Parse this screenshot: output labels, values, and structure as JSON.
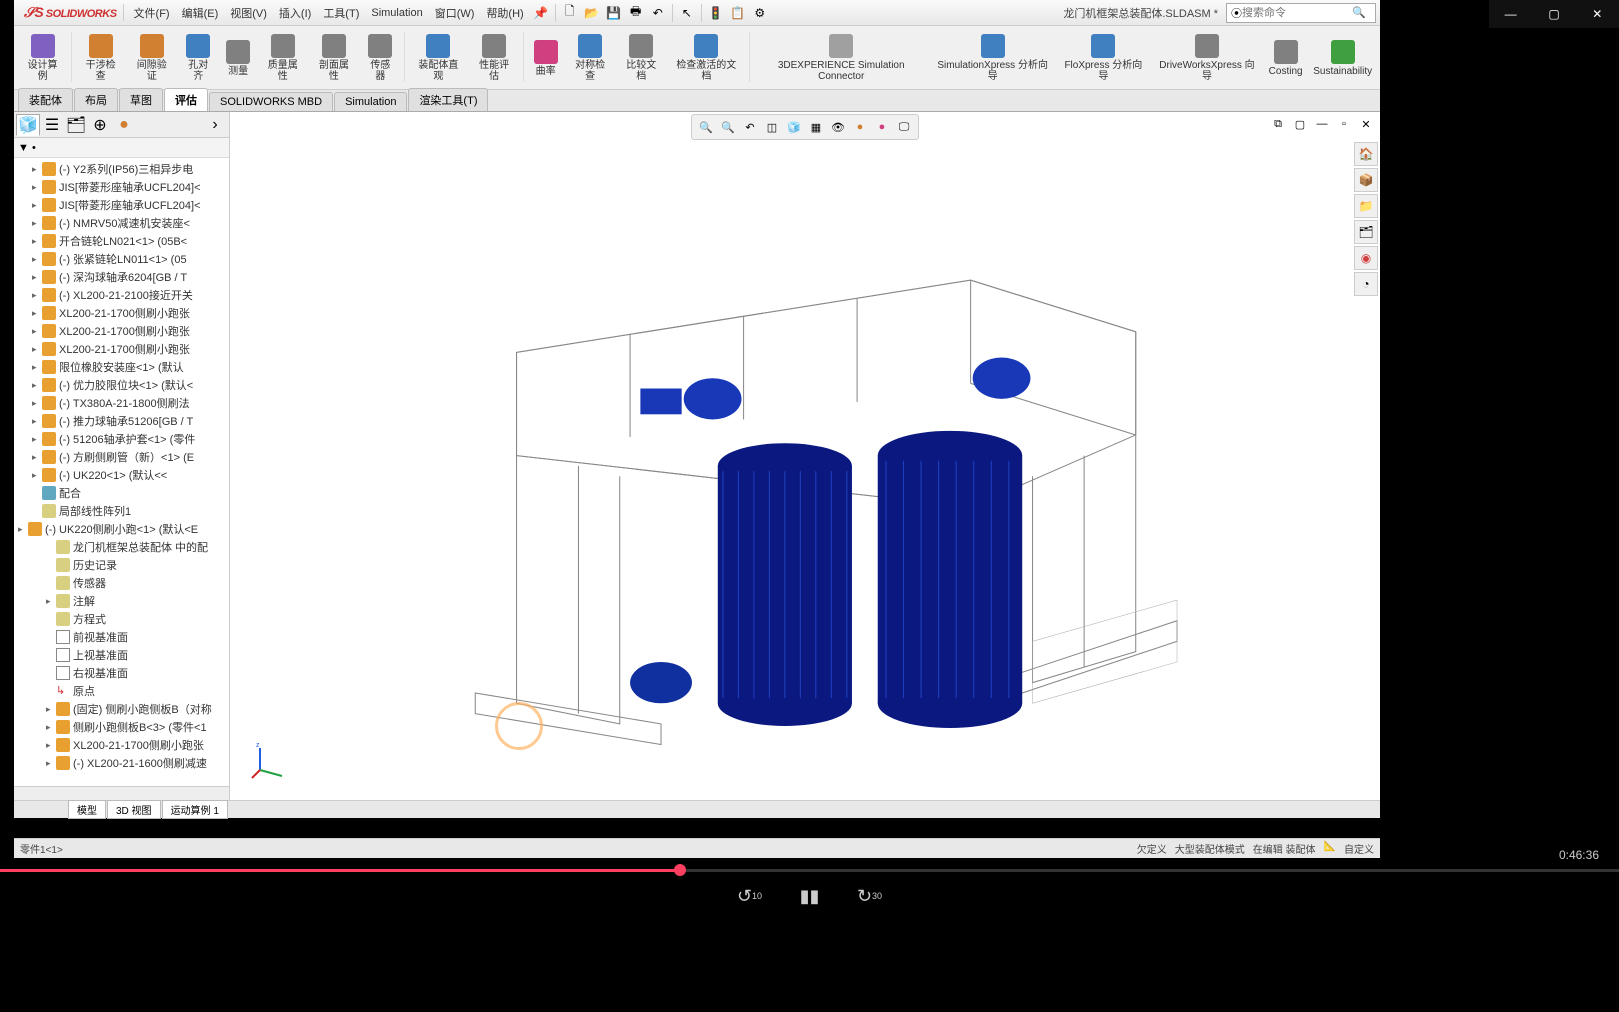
{
  "app": {
    "name": "SOLIDWORKS",
    "doc_title": "龙门机框架总装配体.SLDASM *"
  },
  "search": {
    "placeholder": "搜索命令"
  },
  "menus": [
    "文件(F)",
    "编辑(E)",
    "视图(V)",
    "插入(I)",
    "工具(T)",
    "Simulation",
    "窗口(W)",
    "帮助(H)"
  ],
  "ribbon": {
    "items": [
      {
        "label": "设计算例",
        "icon": "#8060c0"
      },
      {
        "label": "干涉检查",
        "icon": "#d08030"
      },
      {
        "label": "间隙验证",
        "icon": "#d08030"
      },
      {
        "label": "孔对齐",
        "icon": "#4080c0"
      },
      {
        "label": "测量",
        "icon": "#808080"
      },
      {
        "label": "质量属性",
        "icon": "#808080"
      },
      {
        "label": "剖面属性",
        "icon": "#808080"
      },
      {
        "label": "传感器",
        "icon": "#808080"
      },
      {
        "label": "装配体直观",
        "icon": "#4080c0"
      },
      {
        "label": "性能评估",
        "icon": "#808080"
      },
      {
        "label": "曲率",
        "icon": "#d04080"
      },
      {
        "label": "对称检查",
        "icon": "#4080c0"
      },
      {
        "label": "比较文档",
        "icon": "#808080"
      },
      {
        "label": "检查激活的文档",
        "icon": "#4080c0"
      },
      {
        "label": "3DEXPERIENCE Simulation Connector",
        "icon": "#a0a0a0"
      },
      {
        "label": "SimulationXpress 分析向导",
        "icon": "#4080c0"
      },
      {
        "label": "FloXpress 分析向导",
        "icon": "#4080c0"
      },
      {
        "label": "DriveWorksXpress 向导",
        "icon": "#808080"
      },
      {
        "label": "Costing",
        "icon": "#808080"
      },
      {
        "label": "Sustainability",
        "icon": "#40a040"
      }
    ]
  },
  "tabs": [
    "装配体",
    "布局",
    "草图",
    "评估",
    "SOLIDWORKS MBD",
    "Simulation",
    "渲染工具(T)"
  ],
  "active_tab": "评估",
  "tree": {
    "items": [
      {
        "type": "part",
        "expand": true,
        "label": "(-) Y2系列(IP56)三相异步电",
        "i": 1
      },
      {
        "type": "part",
        "expand": true,
        "label": "JIS[带菱形座轴承UCFL204]<",
        "i": 1
      },
      {
        "type": "part",
        "expand": true,
        "label": "JIS[带菱形座轴承UCFL204]<",
        "i": 1
      },
      {
        "type": "part",
        "expand": true,
        "label": "(-) NMRV50减速机安装座<",
        "i": 1
      },
      {
        "type": "part",
        "expand": true,
        "label": "开合链轮LN021<1> (05B<",
        "i": 1
      },
      {
        "type": "part",
        "expand": true,
        "label": "(-) 张紧链轮LN011<1> (05",
        "i": 1
      },
      {
        "type": "part",
        "expand": true,
        "label": "(-) 深沟球轴承6204[GB / T",
        "i": 1
      },
      {
        "type": "part",
        "expand": true,
        "label": "(-) XL200-21-2100接近开关",
        "i": 1
      },
      {
        "type": "part",
        "expand": true,
        "label": "XL200-21-1700侧刷小跑张",
        "i": 1
      },
      {
        "type": "part",
        "expand": true,
        "label": "XL200-21-1700侧刷小跑张",
        "i": 1
      },
      {
        "type": "part",
        "expand": true,
        "label": "XL200-21-1700侧刷小跑张",
        "i": 1
      },
      {
        "type": "part",
        "expand": true,
        "label": "限位橡胶安装座<1> (默认",
        "i": 1
      },
      {
        "type": "part",
        "expand": true,
        "label": "(-) 优力胶限位块<1> (默认<",
        "i": 1
      },
      {
        "type": "part",
        "expand": true,
        "label": "(-) TX380A-21-1800侧刷法",
        "i": 1
      },
      {
        "type": "part",
        "expand": true,
        "label": "(-) 推力球轴承51206[GB / T",
        "i": 1
      },
      {
        "type": "part",
        "expand": true,
        "label": "(-) 51206轴承护套<1> (零件",
        "i": 1
      },
      {
        "type": "part",
        "expand": true,
        "label": "(-) 方刷侧刷管（新）<1> (E",
        "i": 1
      },
      {
        "type": "part",
        "expand": true,
        "label": "(-) UK220<1> (默认<<",
        "i": 1
      },
      {
        "type": "mates",
        "expand": false,
        "label": "配合",
        "i": 1
      },
      {
        "type": "folder",
        "expand": false,
        "label": "局部线性阵列1",
        "i": 1
      },
      {
        "type": "assy",
        "expand": true,
        "label": "(-) UK220侧刷小跑<1> (默认<E",
        "i": 0,
        "open": true
      },
      {
        "type": "folder",
        "expand": false,
        "label": "龙门机框架总装配体 中的配",
        "i": 2
      },
      {
        "type": "folder",
        "expand": false,
        "label": "历史记录",
        "i": 2
      },
      {
        "type": "folder",
        "expand": false,
        "label": "传感器",
        "i": 2
      },
      {
        "type": "folder",
        "expand": true,
        "label": "注解",
        "i": 2
      },
      {
        "type": "folder",
        "expand": false,
        "label": "方程式",
        "i": 2
      },
      {
        "type": "plane",
        "expand": false,
        "label": "前视基准面",
        "i": 2
      },
      {
        "type": "plane",
        "expand": false,
        "label": "上视基准面",
        "i": 2
      },
      {
        "type": "plane",
        "expand": false,
        "label": "右视基准面",
        "i": 2
      },
      {
        "type": "origin",
        "expand": false,
        "label": "原点",
        "i": 2
      },
      {
        "type": "part",
        "expand": true,
        "label": "(固定) 侧刷小跑侧板B（对称",
        "i": 2
      },
      {
        "type": "part",
        "expand": true,
        "label": "侧刷小跑侧板B<3> (零件<1",
        "i": 2
      },
      {
        "type": "part",
        "expand": true,
        "label": "XL200-21-1700侧刷小跑张",
        "i": 2
      },
      {
        "type": "part",
        "expand": true,
        "label": "(-) XL200-21-1600侧刷减速",
        "i": 2
      }
    ]
  },
  "bottom_tabs": [
    "模型",
    "3D 视图",
    "运动算例 1"
  ],
  "status": {
    "left": "零件1<1>",
    "items": [
      "欠定义",
      "大型装配体模式",
      "在编辑 装配体",
      "自定义"
    ]
  },
  "player": {
    "time": "0:46:36",
    "back": "10",
    "fwd": "30"
  }
}
